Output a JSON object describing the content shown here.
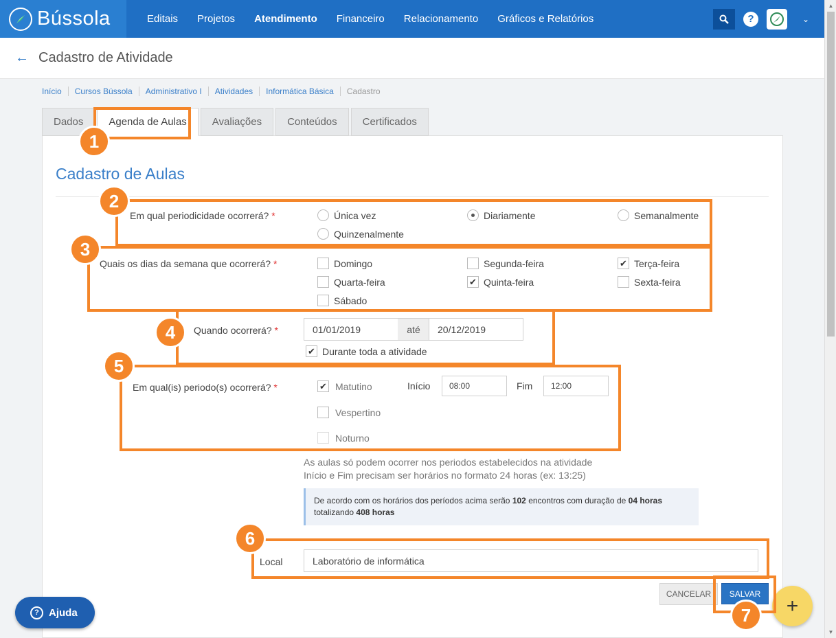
{
  "brand": {
    "name": "Bússola"
  },
  "nav": {
    "items": [
      "Editais",
      "Projetos",
      "Atendimento",
      "Financeiro",
      "Relacionamento",
      "Gráficos e Relatórios"
    ],
    "active": "Atendimento"
  },
  "header": {
    "title": "Cadastro de Atividade"
  },
  "breadcrumb": [
    "Início",
    "Cursos Bússola",
    "Administrativo I",
    "Atividades",
    "Informática Básica",
    "Cadastro"
  ],
  "tabs": [
    "Dados",
    "Agenda de Aulas",
    "Avaliações",
    "Conteúdos",
    "Certificados"
  ],
  "active_tab": "Agenda de Aulas",
  "form": {
    "title": "Cadastro de Aulas",
    "periodicity": {
      "label": "Em qual periodicidade ocorrerá?",
      "required_mark": "*",
      "options": [
        "Única vez",
        "Diariamente",
        "Semanalmente",
        "Quinzenalmente"
      ],
      "selected": "Diariamente"
    },
    "weekdays": {
      "label": "Quais os dias da semana que ocorrerá?",
      "required_mark": "*",
      "options": [
        "Domingo",
        "Segunda-feira",
        "Terça-feira",
        "Quarta-feira",
        "Quinta-feira",
        "Sexta-feira",
        "Sábado"
      ],
      "checked": [
        "Terça-feira",
        "Quinta-feira"
      ]
    },
    "when": {
      "label": "Quando ocorrerá?",
      "required_mark": "*",
      "start": "01/01/2019",
      "separator": "até",
      "end": "20/12/2019",
      "whole_activity_label": "Durante toda a atividade",
      "whole_activity_checked": true
    },
    "periods": {
      "label": "Em qual(is) periodo(s) ocorrerá?",
      "required_mark": "*",
      "start_label": "Início",
      "end_label": "Fim",
      "items": [
        {
          "name": "Matutino",
          "checked": true,
          "start": "08:00",
          "end": "12:00"
        },
        {
          "name": "Vespertino",
          "checked": false
        },
        {
          "name": "Noturno",
          "checked": false,
          "disabled": true
        }
      ]
    },
    "hints": [
      "As aulas só podem ocorrer nos periodos estabelecidos na atividade",
      "Início e Fim precisam ser horários no formato 24 horas (ex: 13:25)"
    ],
    "summary": {
      "prefix": "De acordo com os horários dos períodos acima serão",
      "meetings": "102",
      "middle": "encontros com duração de",
      "duration": "04 horas",
      "totaling": "totalizando",
      "total": "408 horas"
    },
    "location": {
      "label": "Local",
      "value": "Laboratório de informática"
    },
    "cancel_label": "CANCELAR",
    "save_label": "SALVAR"
  },
  "help_button": {
    "label": "Ajuda"
  },
  "fab": {
    "symbol": "+"
  },
  "annotations": [
    "1",
    "2",
    "3",
    "4",
    "5",
    "6",
    "7"
  ],
  "colors": {
    "nav": "#1f6fc4",
    "accent": "#3a7fc9",
    "annotation": "#f4862a",
    "fab": "#f7d766"
  }
}
